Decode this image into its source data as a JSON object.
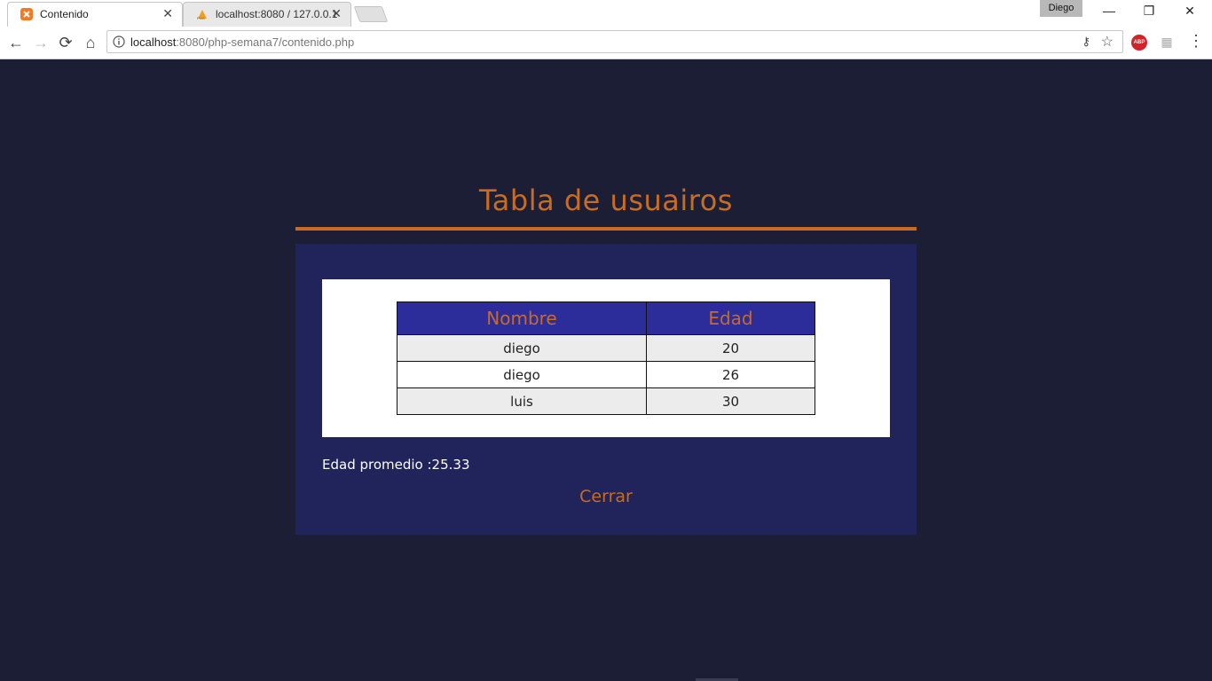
{
  "browser": {
    "tabs": [
      {
        "title": "Contenido",
        "active": true,
        "favicon": "xampp-icon"
      },
      {
        "title": "localhost:8080 / 127.0.0.1",
        "active": false,
        "favicon": "phpmyadmin-icon"
      }
    ],
    "profile_name": "Diego",
    "url_host": "localhost",
    "url_rest": ":8080/php-semana7/contenido.php",
    "colors": {
      "accent": "#c76c22",
      "background": "#1c1e36",
      "panel": "#21245a",
      "header": "#2c2c9a"
    }
  },
  "page": {
    "title": "Tabla de usuairos",
    "table": {
      "headers": [
        "Nombre",
        "Edad"
      ],
      "rows": [
        [
          "diego",
          "20"
        ],
        [
          "diego",
          "26"
        ],
        [
          "luis",
          "30"
        ]
      ]
    },
    "average_label": "Edad promedio :",
    "average_value": "25.33",
    "close_label": "Cerrar"
  }
}
